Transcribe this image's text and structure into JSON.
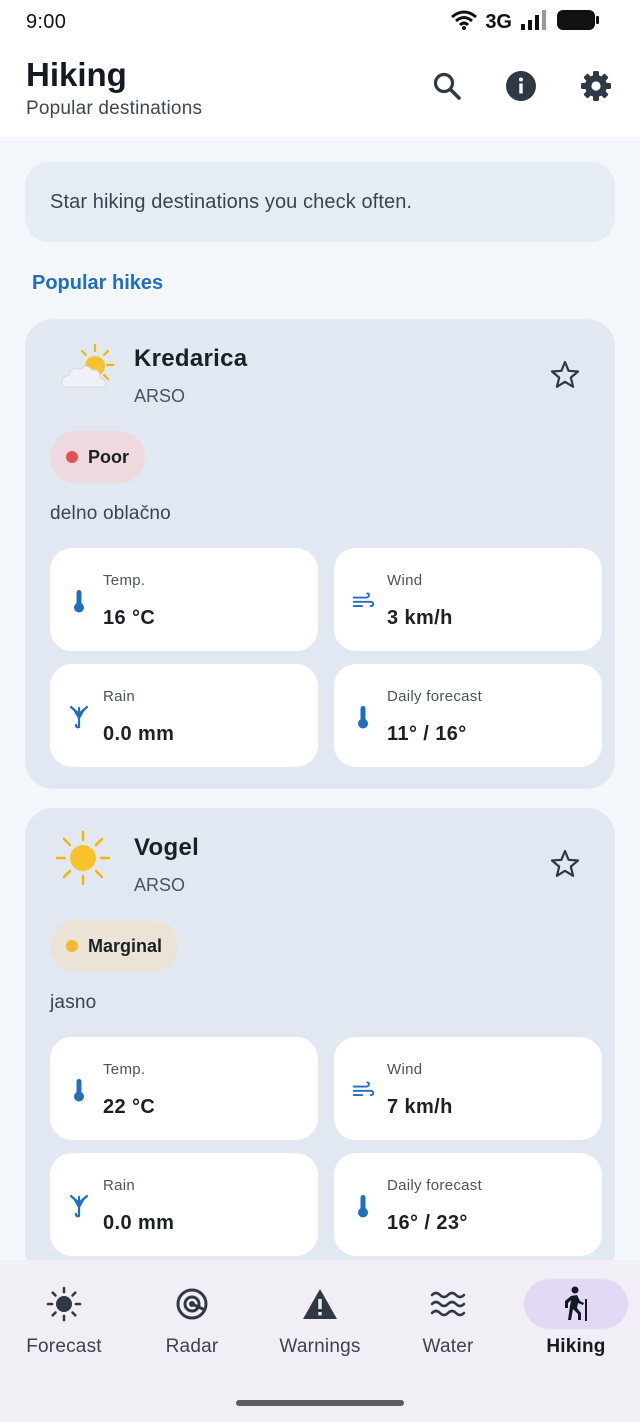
{
  "status_bar": {
    "time": "9:00",
    "network": "3G"
  },
  "app_bar": {
    "title": "Hiking",
    "subtitle": "Popular destinations",
    "actions": [
      "search-icon",
      "info-icon",
      "gear-icon"
    ]
  },
  "banner": {
    "text": "Star hiking destinations you check often."
  },
  "section": {
    "title": "Popular hikes"
  },
  "hikes": [
    {
      "name": "Kredarica",
      "source": "ARSO",
      "weather_icon": "partly-cloudy-icon",
      "condition": "Poor",
      "condition_dot_color": "#e05353",
      "condition_bg_color": "#eed9df",
      "description": "delno oblačno",
      "starred": false,
      "metrics": {
        "temp": {
          "label": "Temp.",
          "value": "16 °C",
          "icon": "thermometer-icon"
        },
        "wind": {
          "label": "Wind",
          "value": "3 km/h",
          "icon": "wind-icon"
        },
        "rain": {
          "label": "Rain",
          "value": "0.0 mm",
          "icon": "umbrella-icon"
        },
        "daily": {
          "label": "Daily forecast",
          "value": "11° / 16°",
          "icon": "thermometer-icon"
        }
      }
    },
    {
      "name": "Vogel",
      "source": "ARSO",
      "weather_icon": "sun-icon",
      "condition": "Marginal",
      "condition_dot_color": "#f5b82e",
      "condition_bg_color": "#ebe4d6",
      "description": "jasno",
      "starred": false,
      "metrics": {
        "temp": {
          "label": "Temp.",
          "value": "22 °C",
          "icon": "thermometer-icon"
        },
        "wind": {
          "label": "Wind",
          "value": "7 km/h",
          "icon": "wind-icon"
        },
        "rain": {
          "label": "Rain",
          "value": "0.0 mm",
          "icon": "umbrella-icon"
        },
        "daily": {
          "label": "Daily forecast",
          "value": "16° / 23°",
          "icon": "thermometer-icon"
        }
      }
    }
  ],
  "bottom_nav": {
    "items": [
      {
        "label": "Forecast",
        "icon": "sun-icon",
        "active": false
      },
      {
        "label": "Radar",
        "icon": "radar-icon",
        "active": false
      },
      {
        "label": "Warnings",
        "icon": "warning-icon",
        "active": false
      },
      {
        "label": "Water",
        "icon": "waves-icon",
        "active": false
      },
      {
        "label": "Hiking",
        "icon": "hiker-icon",
        "active": true
      }
    ]
  },
  "colors": {
    "accent": "#1f6ec0",
    "metric_icon": "#1f6ec0",
    "card_bg": "#e1e8f1",
    "nav_active_pill": "#e4d9f5"
  }
}
